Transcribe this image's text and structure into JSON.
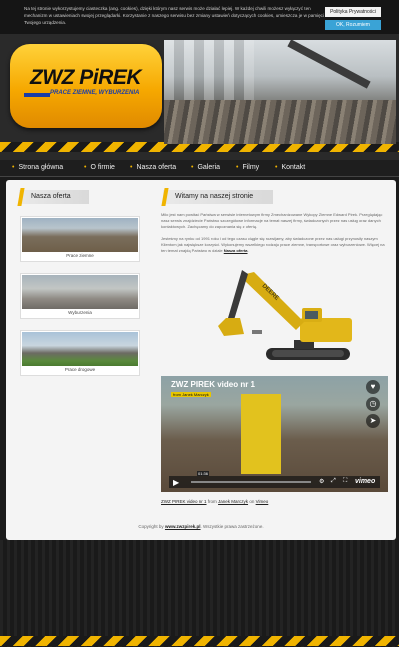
{
  "cookie": {
    "text": "Na tej stronie wykorzystujemy ciasteczka (ang. cookies), dzięki którym nasz serwis może działać lepiej. W każdej chwili możesz wyłączyć ten mechanizm w ustawieniach swojej przeglądarki. Korzystanie z naszego serwisu bez zmiany ustawień dotyczących cookies, umieszcza je w pamięci Twojego urządzenia.",
    "policy_button": "Polityka Prywatności",
    "ok_button": "OK, Rozumiem"
  },
  "header": {
    "logo_title": "ZWZ PiREK",
    "logo_subtitle": "PRACE ZIEMNE, WYBURZENIA"
  },
  "nav": {
    "items": [
      "Strona główna",
      "O firmie",
      "Nasza oferta",
      "Galeria",
      "Filmy",
      "Kontakt"
    ]
  },
  "sidebar": {
    "title": "Nasza oferta",
    "cards": [
      {
        "caption": "Prace ziemne"
      },
      {
        "caption": "Wyburzenia"
      },
      {
        "caption": "Prace drogowe"
      }
    ]
  },
  "main": {
    "title": "Witamy na naszej stronie",
    "para1": "Miło jest nam powitać Państwa w serwisie internetowym firmy Zmechanizowane Wykopy Ziemne Edward Pirek. Przeglądając nasz serwis znajdziecie Państwo szczegółowe informacje na temat naszej firmy, świadczonych przez nas usług oraz danych kontaktowych. Zachęcamy do zapoznania się z ofertą.",
    "para2_text": "Jesteśmy na rynku od 1991 roku i od tego czasu ciągle się rozwijamy, aby świadczone przez nas usługi przynosiły naszym Klientom jak największe korzyści. Wykonujemy wszelkiego rodzaju prace ziemne, transportowe oraz wyburzeniowe. Więcej na ten temat znajdą Państwo w dziale",
    "para2_link": "Nasza oferta",
    "video": {
      "title": "ZWZ PIREK video nr 1",
      "from_label": "from",
      "author": "Janek Marczyk",
      "duration": "01:36",
      "brand": "vimeo"
    },
    "caption": {
      "link": "ZWZ PIREK video nr 1",
      "from": "from",
      "author": "Janek Marczyk",
      "on": "on",
      "site": "Vimeo"
    }
  },
  "footer": {
    "prefix": "Copyright by",
    "link": "www.zwzpirek.pl",
    "suffix": ". Wszystkie prawa zastrzeżone."
  },
  "colors": {
    "accent": "#f0b400",
    "vimeo_blue": "#3aa3d6",
    "logo_blue": "#1a3da8"
  }
}
